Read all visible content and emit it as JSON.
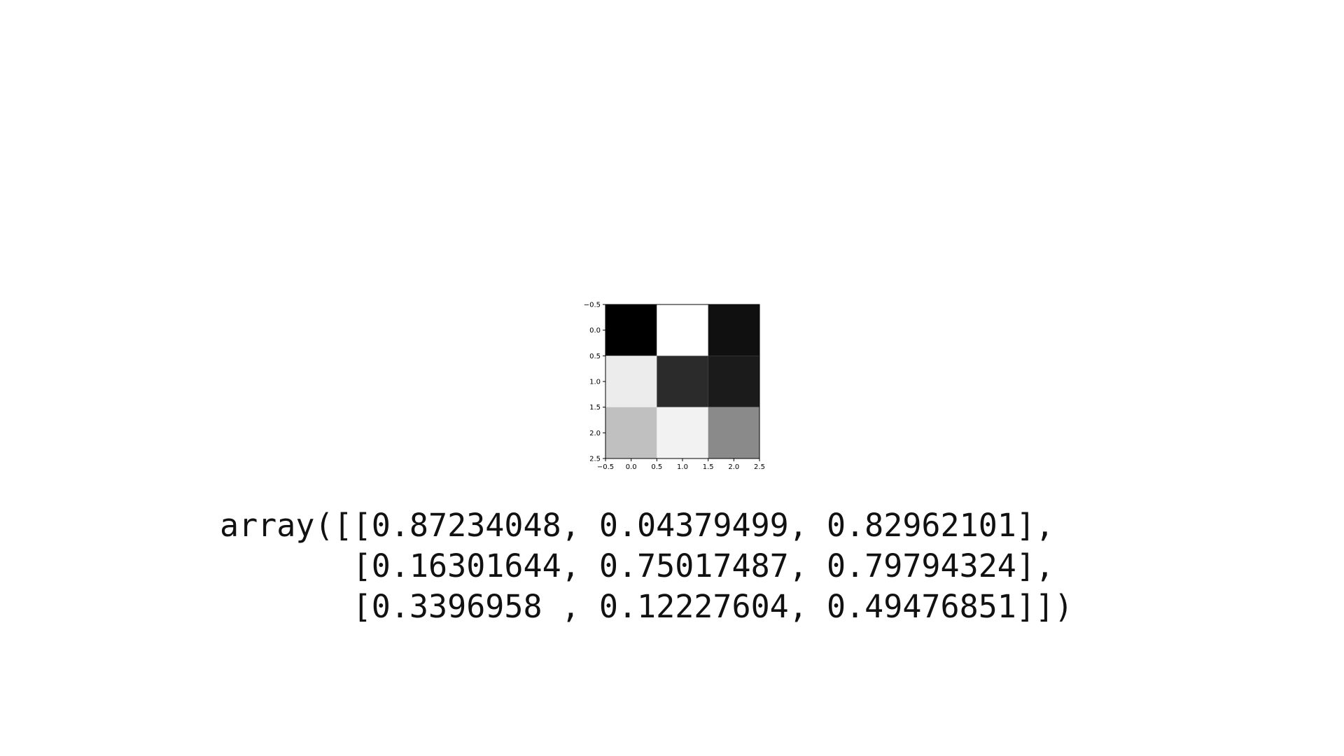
{
  "chart_data": {
    "type": "heatmap",
    "colormap": "gray",
    "matrix": [
      [
        0.87234048,
        0.04379499,
        0.82962101
      ],
      [
        0.16301644,
        0.75017487,
        0.79794324
      ],
      [
        0.3396958,
        0.12227604,
        0.49476851
      ]
    ],
    "xlim": [
      -0.5,
      2.5
    ],
    "ylim": [
      2.5,
      -0.5
    ],
    "x_ticks": [
      "−0.5",
      "0.0",
      "0.5",
      "1.0",
      "1.5",
      "2.0",
      "2.5"
    ],
    "y_ticks": [
      "−0.5",
      "0.0",
      "0.5",
      "1.0",
      "1.5",
      "2.0",
      "2.5"
    ],
    "title": "",
    "xlabel": "",
    "ylabel": "",
    "colors": {
      "cells": [
        [
          "#000000",
          "#ffffff",
          "#101010"
        ],
        [
          "#ececec",
          "#2b2b2b",
          "#1b1b1b"
        ],
        [
          "#c0c0c0",
          "#f2f2f2",
          "#8a8a8a"
        ]
      ]
    }
  },
  "output": {
    "lines": [
      "array([[0.87234048, 0.04379499, 0.82962101],",
      "       [0.16301644, 0.75017487, 0.79794324],",
      "       [0.3396958 , 0.12227604, 0.49476851]])"
    ]
  }
}
